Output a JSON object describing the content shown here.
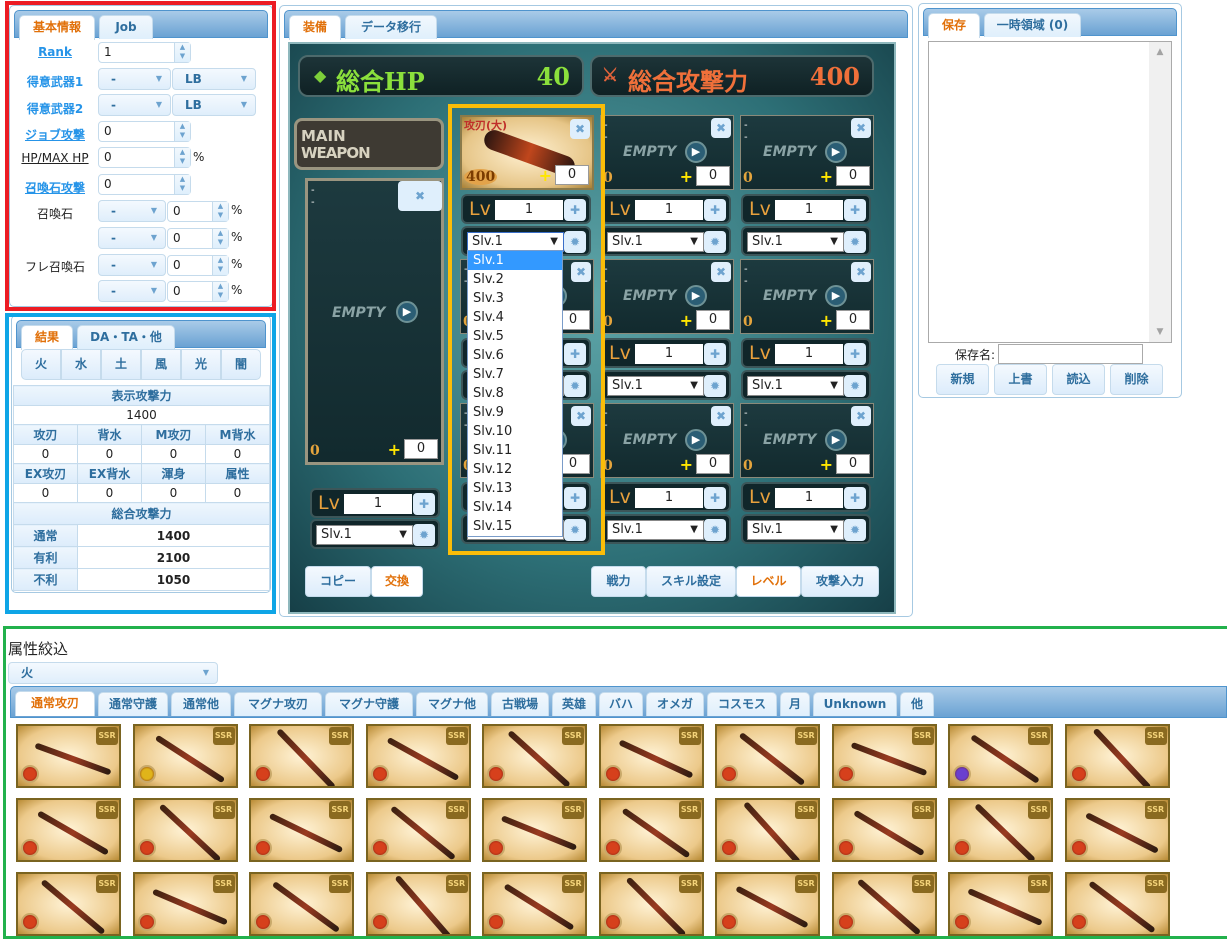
{
  "basic": {
    "tabs": [
      "基本情報",
      "Job"
    ],
    "rank": {
      "label": "Rank",
      "value": "1"
    },
    "weapon1": {
      "label": "得意武器1",
      "type": "-",
      "lb": "LB"
    },
    "weapon2": {
      "label": "得意武器2",
      "type": "-",
      "lb": "LB"
    },
    "job_atk": {
      "label": "ジョブ攻撃",
      "value": "0"
    },
    "hp": {
      "label": "HP/MAX HP",
      "value": "0",
      "unit": "%"
    },
    "summon_atk": {
      "label": "召喚石攻撃",
      "value": "0"
    },
    "summon": {
      "label": "召喚石",
      "rows": [
        {
          "sel": "-",
          "value": "0",
          "unit": "%"
        },
        {
          "sel": "-",
          "value": "0",
          "unit": "%"
        }
      ]
    },
    "friend": {
      "label": "フレ召喚石",
      "rows": [
        {
          "sel": "-",
          "value": "0",
          "unit": "%"
        },
        {
          "sel": "-",
          "value": "0",
          "unit": "%"
        }
      ]
    }
  },
  "result": {
    "tabs": [
      "結果",
      "DA・TA・他"
    ],
    "elements": [
      "火",
      "水",
      "土",
      "風",
      "光",
      "闇"
    ],
    "display_atk_label": "表示攻撃力",
    "display_atk": "1400",
    "row1_labels": [
      "攻刃",
      "背水",
      "M攻刃",
      "M背水"
    ],
    "row1_values": [
      "0",
      "0",
      "0",
      "0"
    ],
    "row2_labels": [
      "EX攻刃",
      "EX背水",
      "渾身",
      "属性"
    ],
    "row2_values": [
      "0",
      "0",
      "0",
      "0"
    ],
    "total_label": "総合攻撃力",
    "totals": [
      {
        "label": "通常",
        "value": "1400"
      },
      {
        "label": "有利",
        "value": "2100"
      },
      {
        "label": "不利",
        "value": "1050"
      }
    ]
  },
  "equip": {
    "tabs": [
      "装備",
      "データ移行"
    ],
    "hp_label": "総合HP",
    "hp_value": "40",
    "atk_label": "総合攻撃力",
    "atk_value": "400",
    "main_label": [
      "MAIN",
      "WEAPON"
    ],
    "main": {
      "lines": [
        "-",
        "-"
      ],
      "empty": "EMPTY",
      "atk": "0",
      "plus": "0",
      "lv_label": "Lv",
      "lv": "1",
      "slv": "Slv.1"
    },
    "slots": [
      {
        "filled": true,
        "skill": "攻刃(大)",
        "atk": "400",
        "plus": "0",
        "lv": "1",
        "slv": "Slv.1"
      },
      {
        "filled": false,
        "lines": [
          "-",
          "-"
        ],
        "empty": "EMPTY",
        "atk": "0",
        "plus": "0",
        "lv": "1",
        "slv": "Slv.1"
      },
      {
        "filled": false,
        "lines": [
          "-",
          "-"
        ],
        "empty": "EMPTY",
        "atk": "0",
        "plus": "0",
        "lv": "1",
        "slv": "Slv.1"
      },
      {
        "filled": false,
        "lines": [
          "-",
          "-"
        ],
        "empty": "EMPTY",
        "atk": "0",
        "plus": "0",
        "lv": "1",
        "slv": "Slv.1"
      },
      {
        "filled": false,
        "lines": [
          "-",
          "-"
        ],
        "empty": "EMPTY",
        "atk": "0",
        "plus": "0",
        "lv": "1",
        "slv": "Slv.1"
      },
      {
        "filled": false,
        "lines": [
          "-",
          "-"
        ],
        "empty": "EMPTY",
        "atk": "0",
        "plus": "0",
        "lv": "1",
        "slv": "Slv.1"
      },
      {
        "filled": false,
        "lines": [
          "-",
          "-"
        ],
        "empty": "EMPTY",
        "atk": "0",
        "plus": "0",
        "lv": "1",
        "slv": "Slv.1"
      },
      {
        "filled": false,
        "lines": [
          "-",
          "-"
        ],
        "empty": "EMPTY",
        "atk": "0",
        "plus": "0",
        "lv": "1",
        "slv": "Slv.1"
      },
      {
        "filled": false,
        "lines": [
          "-",
          "-"
        ],
        "empty": "EMPTY",
        "atk": "0",
        "plus": "0",
        "lv": "1",
        "slv": "Slv.1"
      }
    ],
    "slv_options": [
      "Slv.1",
      "Slv.2",
      "Slv.3",
      "Slv.4",
      "Slv.5",
      "Slv.6",
      "Slv.7",
      "Slv.8",
      "Slv.9",
      "Slv.10",
      "Slv.11",
      "Slv.12",
      "Slv.13",
      "Slv.14",
      "Slv.15"
    ],
    "slv_selected": "Slv.1",
    "left_buttons": [
      "コピー",
      "交換"
    ],
    "left_active": "交換",
    "right_buttons": [
      "戦力",
      "スキル設定",
      "レベル",
      "攻撃入力"
    ],
    "right_active": "レベル"
  },
  "save": {
    "tabs": [
      "保存",
      "一時領域 (0)"
    ],
    "name_label": "保存名:",
    "name_value": "",
    "buttons": [
      "新規",
      "上書",
      "読込",
      "削除"
    ]
  },
  "filter": {
    "title": "属性絞込",
    "element": "火",
    "tabs": [
      "通常攻刃",
      "通常守護",
      "通常他",
      "マグナ攻刃",
      "マグナ守護",
      "マグナ他",
      "古戦場",
      "英雄",
      "バハ",
      "オメガ",
      "コスモス",
      "月",
      "Unknown",
      "他"
    ],
    "active_tab": "通常攻刃",
    "rarity": "SSR",
    "weapon_elements": [
      "fire",
      "light",
      "fire",
      "fire",
      "fire",
      "fire",
      "fire",
      "fire",
      "dark",
      "fire",
      "fire",
      "fire",
      "fire",
      "fire",
      "fire",
      "fire",
      "fire",
      "fire",
      "fire",
      "fire",
      "fire",
      "fire",
      "fire",
      "fire",
      "fire",
      "fire",
      "fire",
      "fire",
      "fire",
      "fire"
    ]
  },
  "colors": {
    "accent": "#e17009",
    "link": "#2694e8",
    "tab_text": "#2e6e9e",
    "highlight": "#3399ff",
    "fire": "#d6401c",
    "light": "#e0b41a",
    "dark": "#6a3fd0",
    "outline_red": "#ec1c24",
    "outline_blue": "#0ea5e6",
    "outline_yellow": "#fbbd08",
    "outline_green": "#22b14c"
  }
}
